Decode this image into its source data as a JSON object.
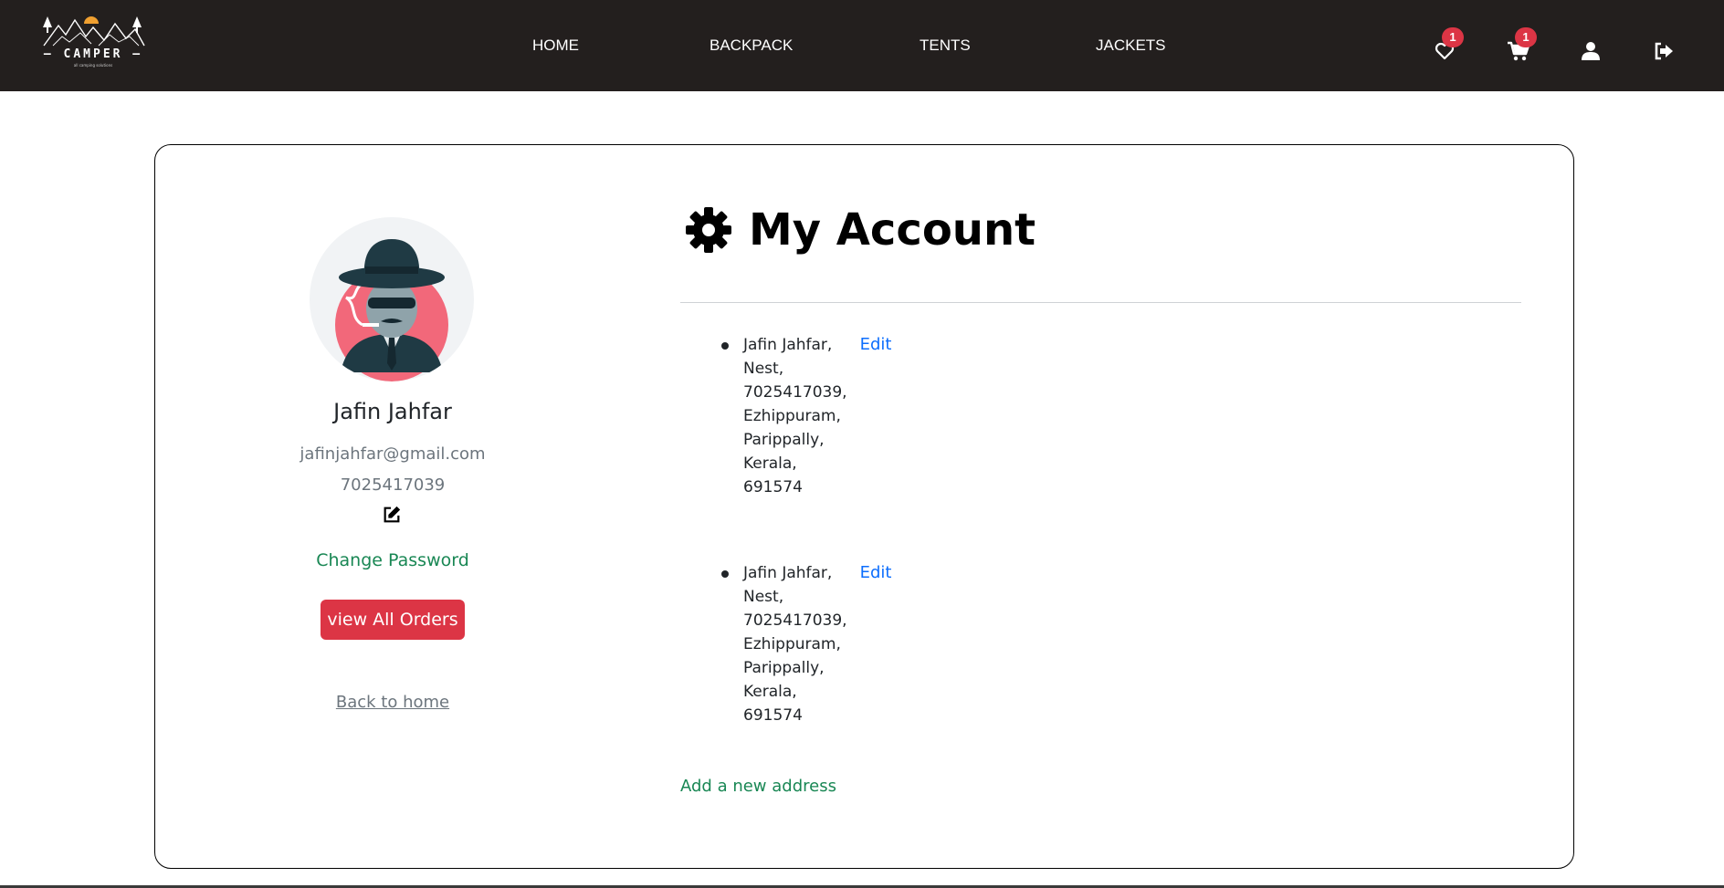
{
  "brand": {
    "name": "CAMPER",
    "tagline": "all camping solutions"
  },
  "nav": {
    "links": [
      "HOME",
      "BACKPACK",
      "TENTS",
      "JACKETS"
    ],
    "wishlist_count": "1",
    "cart_count": "1"
  },
  "profile": {
    "name": "Jafin Jahfar",
    "email": "jafinjahfar@gmail.com",
    "phone": "7025417039",
    "change_password": "Change Password",
    "view_orders": "view All Orders",
    "back_home": "Back to home"
  },
  "account": {
    "title": "My Account",
    "addresses": [
      {
        "lines": [
          "Jafin Jahfar,",
          "Nest,",
          "7025417039,",
          "Ezhippuram,",
          "Parippally,",
          "Kerala,",
          "691574"
        ],
        "edit": "Edit"
      },
      {
        "lines": [
          "Jafin Jahfar,",
          "Nest,",
          "7025417039,",
          "Ezhippuram,",
          "Parippally,",
          "Kerala,",
          "691574"
        ],
        "edit": "Edit"
      }
    ],
    "add_address": "Add a new address"
  },
  "colors": {
    "navbar": "#231f1e",
    "badge": "#dc3545",
    "success": "#198754",
    "link": "#0d6efd",
    "button": "#dc3545"
  },
  "icons": [
    "heart-icon",
    "cart-icon",
    "user-icon",
    "logout-icon",
    "edit-icon",
    "gear-icon"
  ]
}
